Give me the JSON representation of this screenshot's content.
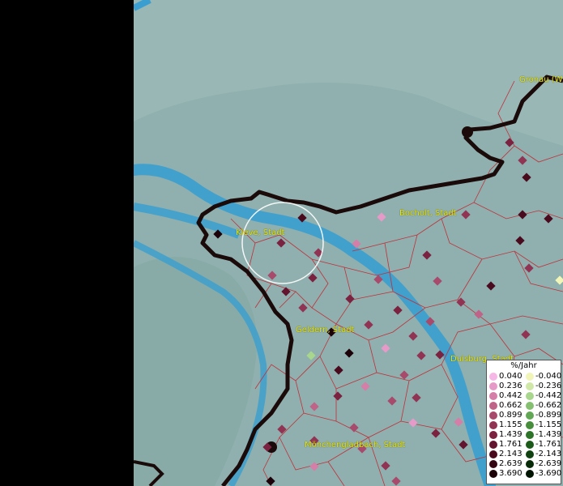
{
  "map": {
    "labels": {
      "gronau": "Gronau (W",
      "bocholt": "Bocholt, Stadt",
      "kleve": "Kleve, Stadt",
      "geldern": "Geldern, Stadt",
      "duisburg": "Duisburg, Stadt",
      "moenchengladbach": "Mönchengladbach, Stadt"
    },
    "colors": {
      "terrain": "#8fb0ae",
      "water": "#3a9fd0",
      "border": "#1a0a0a",
      "districts": "#c0303a",
      "labels": "#e8e800"
    }
  },
  "legend": {
    "title": "%/Jahr",
    "positive": [
      {
        "value": "0.040",
        "color": "#f5b8e6"
      },
      {
        "value": "0.236",
        "color": "#e69ac8"
      },
      {
        "value": "0.442",
        "color": "#d47ea8"
      },
      {
        "value": "0.662",
        "color": "#c06388"
      },
      {
        "value": "0.899",
        "color": "#a84a6c"
      },
      {
        "value": "1.155",
        "color": "#913454"
      },
      {
        "value": "1.439",
        "color": "#7a2240"
      },
      {
        "value": "1.761",
        "color": "#63142e"
      },
      {
        "value": "2.143",
        "color": "#4a0a1e"
      },
      {
        "value": "2.639",
        "color": "#330512"
      },
      {
        "value": "3.690",
        "color": "#1c0208"
      }
    ],
    "negative": [
      {
        "value": "-0.040",
        "color": "#f2f5b8"
      },
      {
        "value": "-0.236",
        "color": "#cfe8a8"
      },
      {
        "value": "-0.442",
        "color": "#a8d68c"
      },
      {
        "value": "-0.662",
        "color": "#84c070"
      },
      {
        "value": "-0.899",
        "color": "#62a854"
      },
      {
        "value": "-1.155",
        "color": "#468e3c"
      },
      {
        "value": "-1.439",
        "color": "#2e7428"
      },
      {
        "value": "-1.761",
        "color": "#1c5a1a"
      },
      {
        "value": "-2.143",
        "color": "#0f4210"
      },
      {
        "value": "-2.639",
        "color": "#072a08"
      },
      {
        "value": "-3.690",
        "color": "#021402"
      }
    ]
  }
}
